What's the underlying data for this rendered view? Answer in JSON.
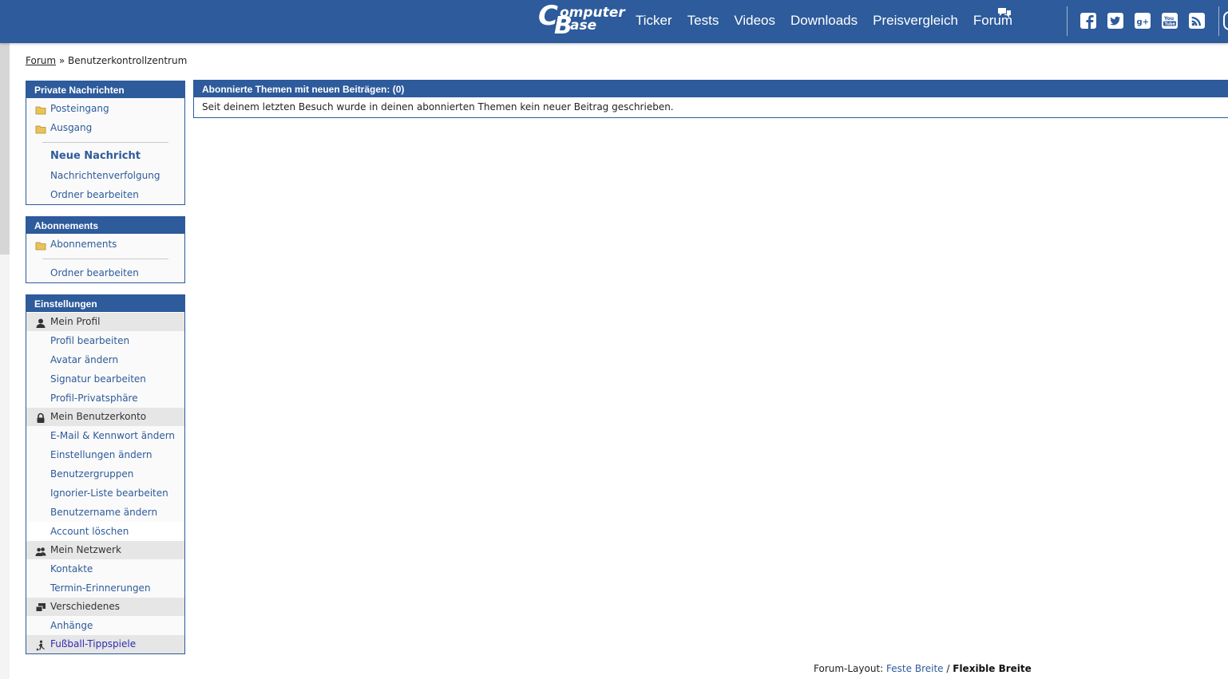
{
  "header": {
    "logo": {
      "c": "C",
      "word1": "omputer",
      "b": "B",
      "word2": "ase"
    },
    "nav": [
      "Ticker",
      "Tests",
      "Videos",
      "Downloads",
      "Preisvergleich",
      "Forum"
    ],
    "social_icons": [
      "facebook-icon",
      "twitter-icon",
      "google-plus-icon",
      "youtube-icon",
      "rss-icon"
    ],
    "brand_color": "#2d5b9b"
  },
  "breadcrumb": {
    "link": "Forum",
    "sep": "»",
    "current": "Benutzerkontrollzentrum"
  },
  "panels": {
    "private": {
      "title": "Private Nachrichten",
      "items": [
        "Posteingang",
        "Ausgang",
        "Neue Nachricht",
        "Nachrichtenverfolgung",
        "Ordner bearbeiten"
      ]
    },
    "subs": {
      "title": "Abonnements",
      "items": [
        "Abonnements",
        "Ordner bearbeiten"
      ]
    },
    "settings": {
      "title": "Einstellungen",
      "groups": [
        "Mein Profil",
        "Mein Benutzerkonto",
        "Mein Netzwerk",
        "Verschiedenes",
        "Fußball-Tippspiele"
      ],
      "profile": [
        "Profil bearbeiten",
        "Avatar ändern",
        "Signatur bearbeiten",
        "Profil-Privatsphäre"
      ],
      "account": [
        "E-Mail & Kennwort ändern",
        "Einstellungen ändern",
        "Benutzergruppen",
        "Ignorier-Liste bearbeiten",
        "Benutzername ändern",
        "Account löschen"
      ],
      "network": [
        "Kontakte",
        "Termin-Erinnerungen"
      ],
      "misc": [
        "Anhänge"
      ]
    }
  },
  "main": {
    "title": "Abonnierte Themen mit neuen Beiträgen: (0)",
    "message": "Seit deinem letzten Besuch wurde in deinen abonnierten Themen kein neuer Beitrag geschrieben."
  },
  "footer": {
    "label": "Forum-Layout:",
    "fixed": "Feste Breite",
    "sep": "/",
    "flexible": "Flexible Breite"
  },
  "highlight_color": "#fbfb1f"
}
